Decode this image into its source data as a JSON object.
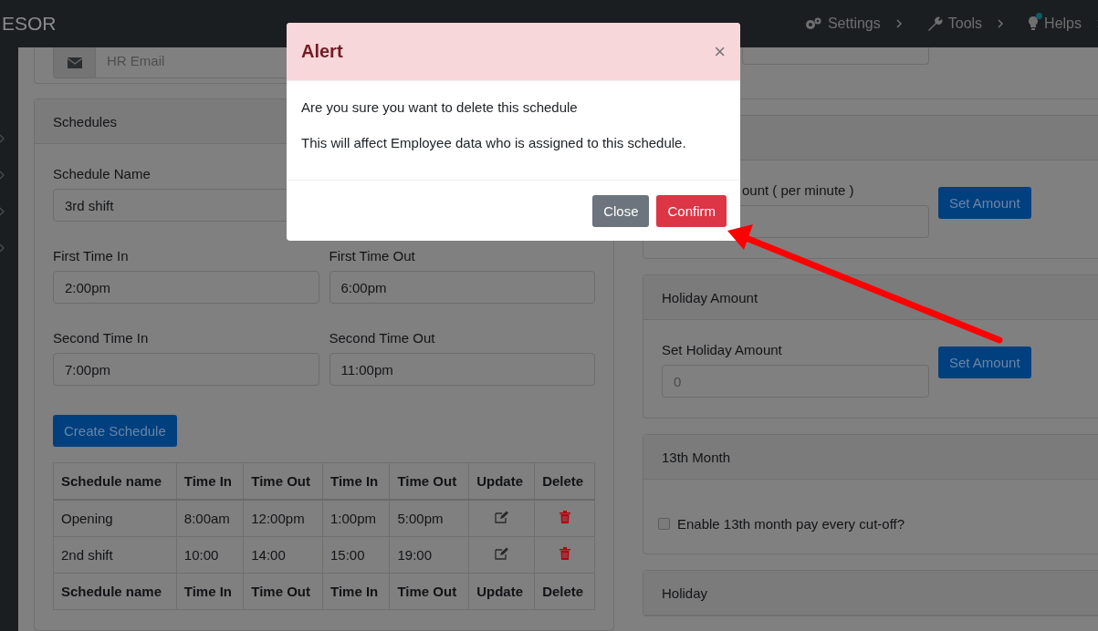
{
  "navbar": {
    "brand": "ESOR",
    "items": [
      {
        "label": "Settings",
        "kind": "gear",
        "notification": false
      },
      {
        "label": "Tools",
        "kind": "wrench",
        "notification": false
      },
      {
        "label": "Helps",
        "kind": "bulb",
        "notification": true
      }
    ]
  },
  "hr_card": {
    "placeholder": "HR Email"
  },
  "schedules": {
    "title": "Schedules",
    "name_field": {
      "label": "Schedule Name",
      "value": "3rd shift"
    },
    "time_fields": [
      {
        "label": "First Time In",
        "value": "2:00pm"
      },
      {
        "label": "First Time Out",
        "value": "6:00pm"
      },
      {
        "label": "Second Time In",
        "value": "7:00pm"
      },
      {
        "label": "Second Time Out",
        "value": "11:00pm"
      }
    ],
    "create_button": "Create Schedule",
    "table": {
      "columns": [
        "Schedule name",
        "Time In",
        "Time Out",
        "Time In",
        "Time Out",
        "Update",
        "Delete"
      ],
      "rows": [
        [
          "Opening",
          "8:00am",
          "12:00pm",
          "1:00pm",
          "5:00pm"
        ],
        [
          "2nd shift",
          "10:00",
          "14:00",
          "15:00",
          "19:00"
        ]
      ],
      "footer": [
        "Schedule name",
        "Time In",
        "Time Out",
        "Time In",
        "Time Out",
        "Update",
        "Delete"
      ]
    }
  },
  "rate_card": {
    "label": "ount ( per minute )",
    "button": "Set Amount"
  },
  "holiday_amount": {
    "title": "Holiday Amount",
    "label": "Set Holiday Amount",
    "placeholder": "0",
    "button": "Set Amount"
  },
  "thirteenth_month": {
    "title": "13th Month",
    "checkbox": {
      "label": "Enable 13th month pay every cut-off?",
      "checked": false
    }
  },
  "holiday": {
    "title": "Holiday"
  },
  "modal": {
    "title": "Alert",
    "close_glyph": "×",
    "messages": [
      "Are you sure you want to delete this schedule",
      "This will affect Employee data who is assigned to this schedule."
    ],
    "buttons": [
      {
        "label": "Close",
        "kind": "secondary"
      },
      {
        "label": "Confirm",
        "kind": "danger"
      }
    ]
  }
}
